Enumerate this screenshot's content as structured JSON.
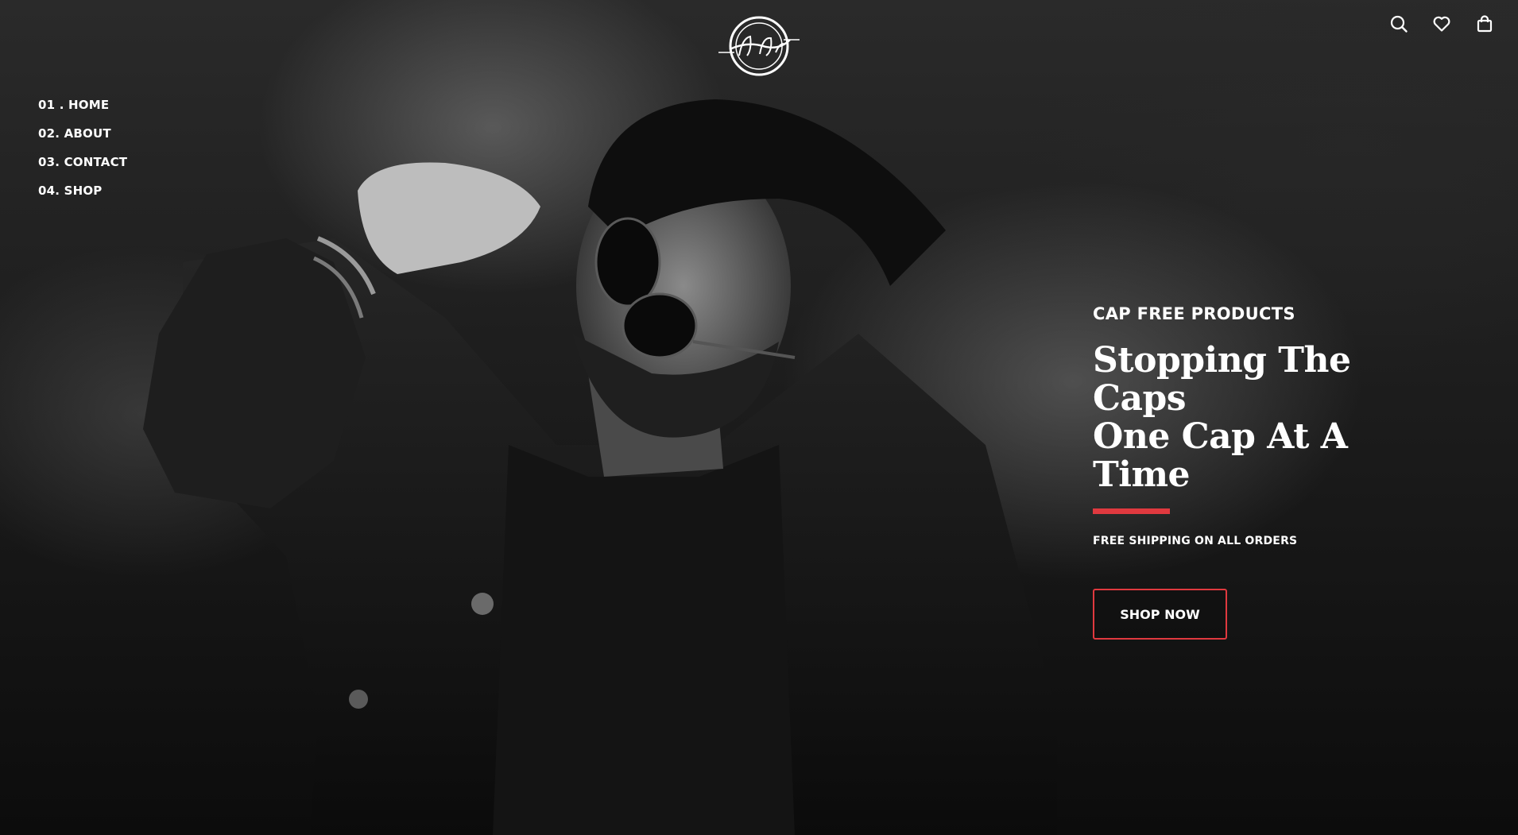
{
  "brand": {
    "logo_text": "Stop The Cap"
  },
  "header": {
    "icons": [
      "search-icon",
      "heart-icon",
      "shopping-bag-icon"
    ]
  },
  "nav": {
    "items": [
      {
        "label": "01 . HOME"
      },
      {
        "label": "02. ABOUT"
      },
      {
        "label": "03. CONTACT"
      },
      {
        "label": "04. SHOP"
      }
    ]
  },
  "hero": {
    "eyebrow": "CAP FREE PRODUCTS",
    "headline_line1": "Stopping The Caps",
    "headline_line2": "One Cap At A Time",
    "shipping_note": "FREE SHIPPING ON ALL ORDERS",
    "cta_label": "SHOP NOW"
  },
  "colors": {
    "accent": "#e0393f",
    "text": "#ffffff",
    "background": "#1a1a1a"
  }
}
